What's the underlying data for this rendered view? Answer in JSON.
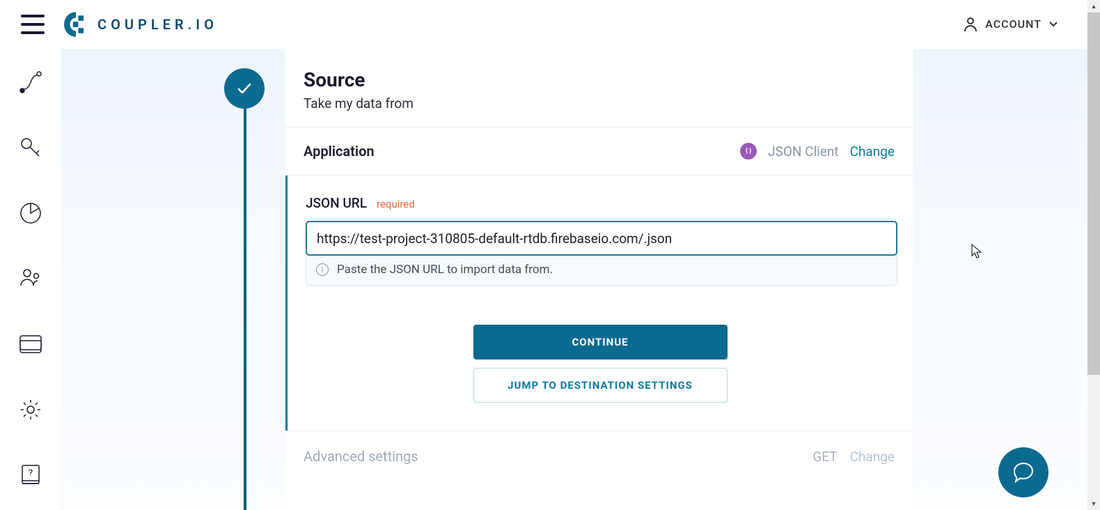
{
  "header": {
    "logo_text": "COUPLER.IO",
    "account_label": "ACCOUNT"
  },
  "sidebar": {
    "items": [
      {
        "name": "flows"
      },
      {
        "name": "connections"
      },
      {
        "name": "usage"
      },
      {
        "name": "team"
      },
      {
        "name": "billing"
      },
      {
        "name": "settings"
      },
      {
        "name": "help"
      }
    ]
  },
  "main": {
    "source": {
      "title": "Source",
      "subtitle": "Take my data from"
    },
    "application": {
      "label": "Application",
      "selected": "JSON Client",
      "change": "Change"
    },
    "json_url": {
      "label": "JSON URL",
      "required": "required",
      "value": "https://test-project-310805-default-rtdb.firebaseio.com/.json",
      "hint": "Paste the JSON URL to import data from."
    },
    "buttons": {
      "continue": "CONTINUE",
      "jump": "JUMP TO DESTINATION SETTINGS"
    },
    "advanced": {
      "label": "Advanced settings",
      "method": "GET",
      "change": "Change"
    }
  }
}
